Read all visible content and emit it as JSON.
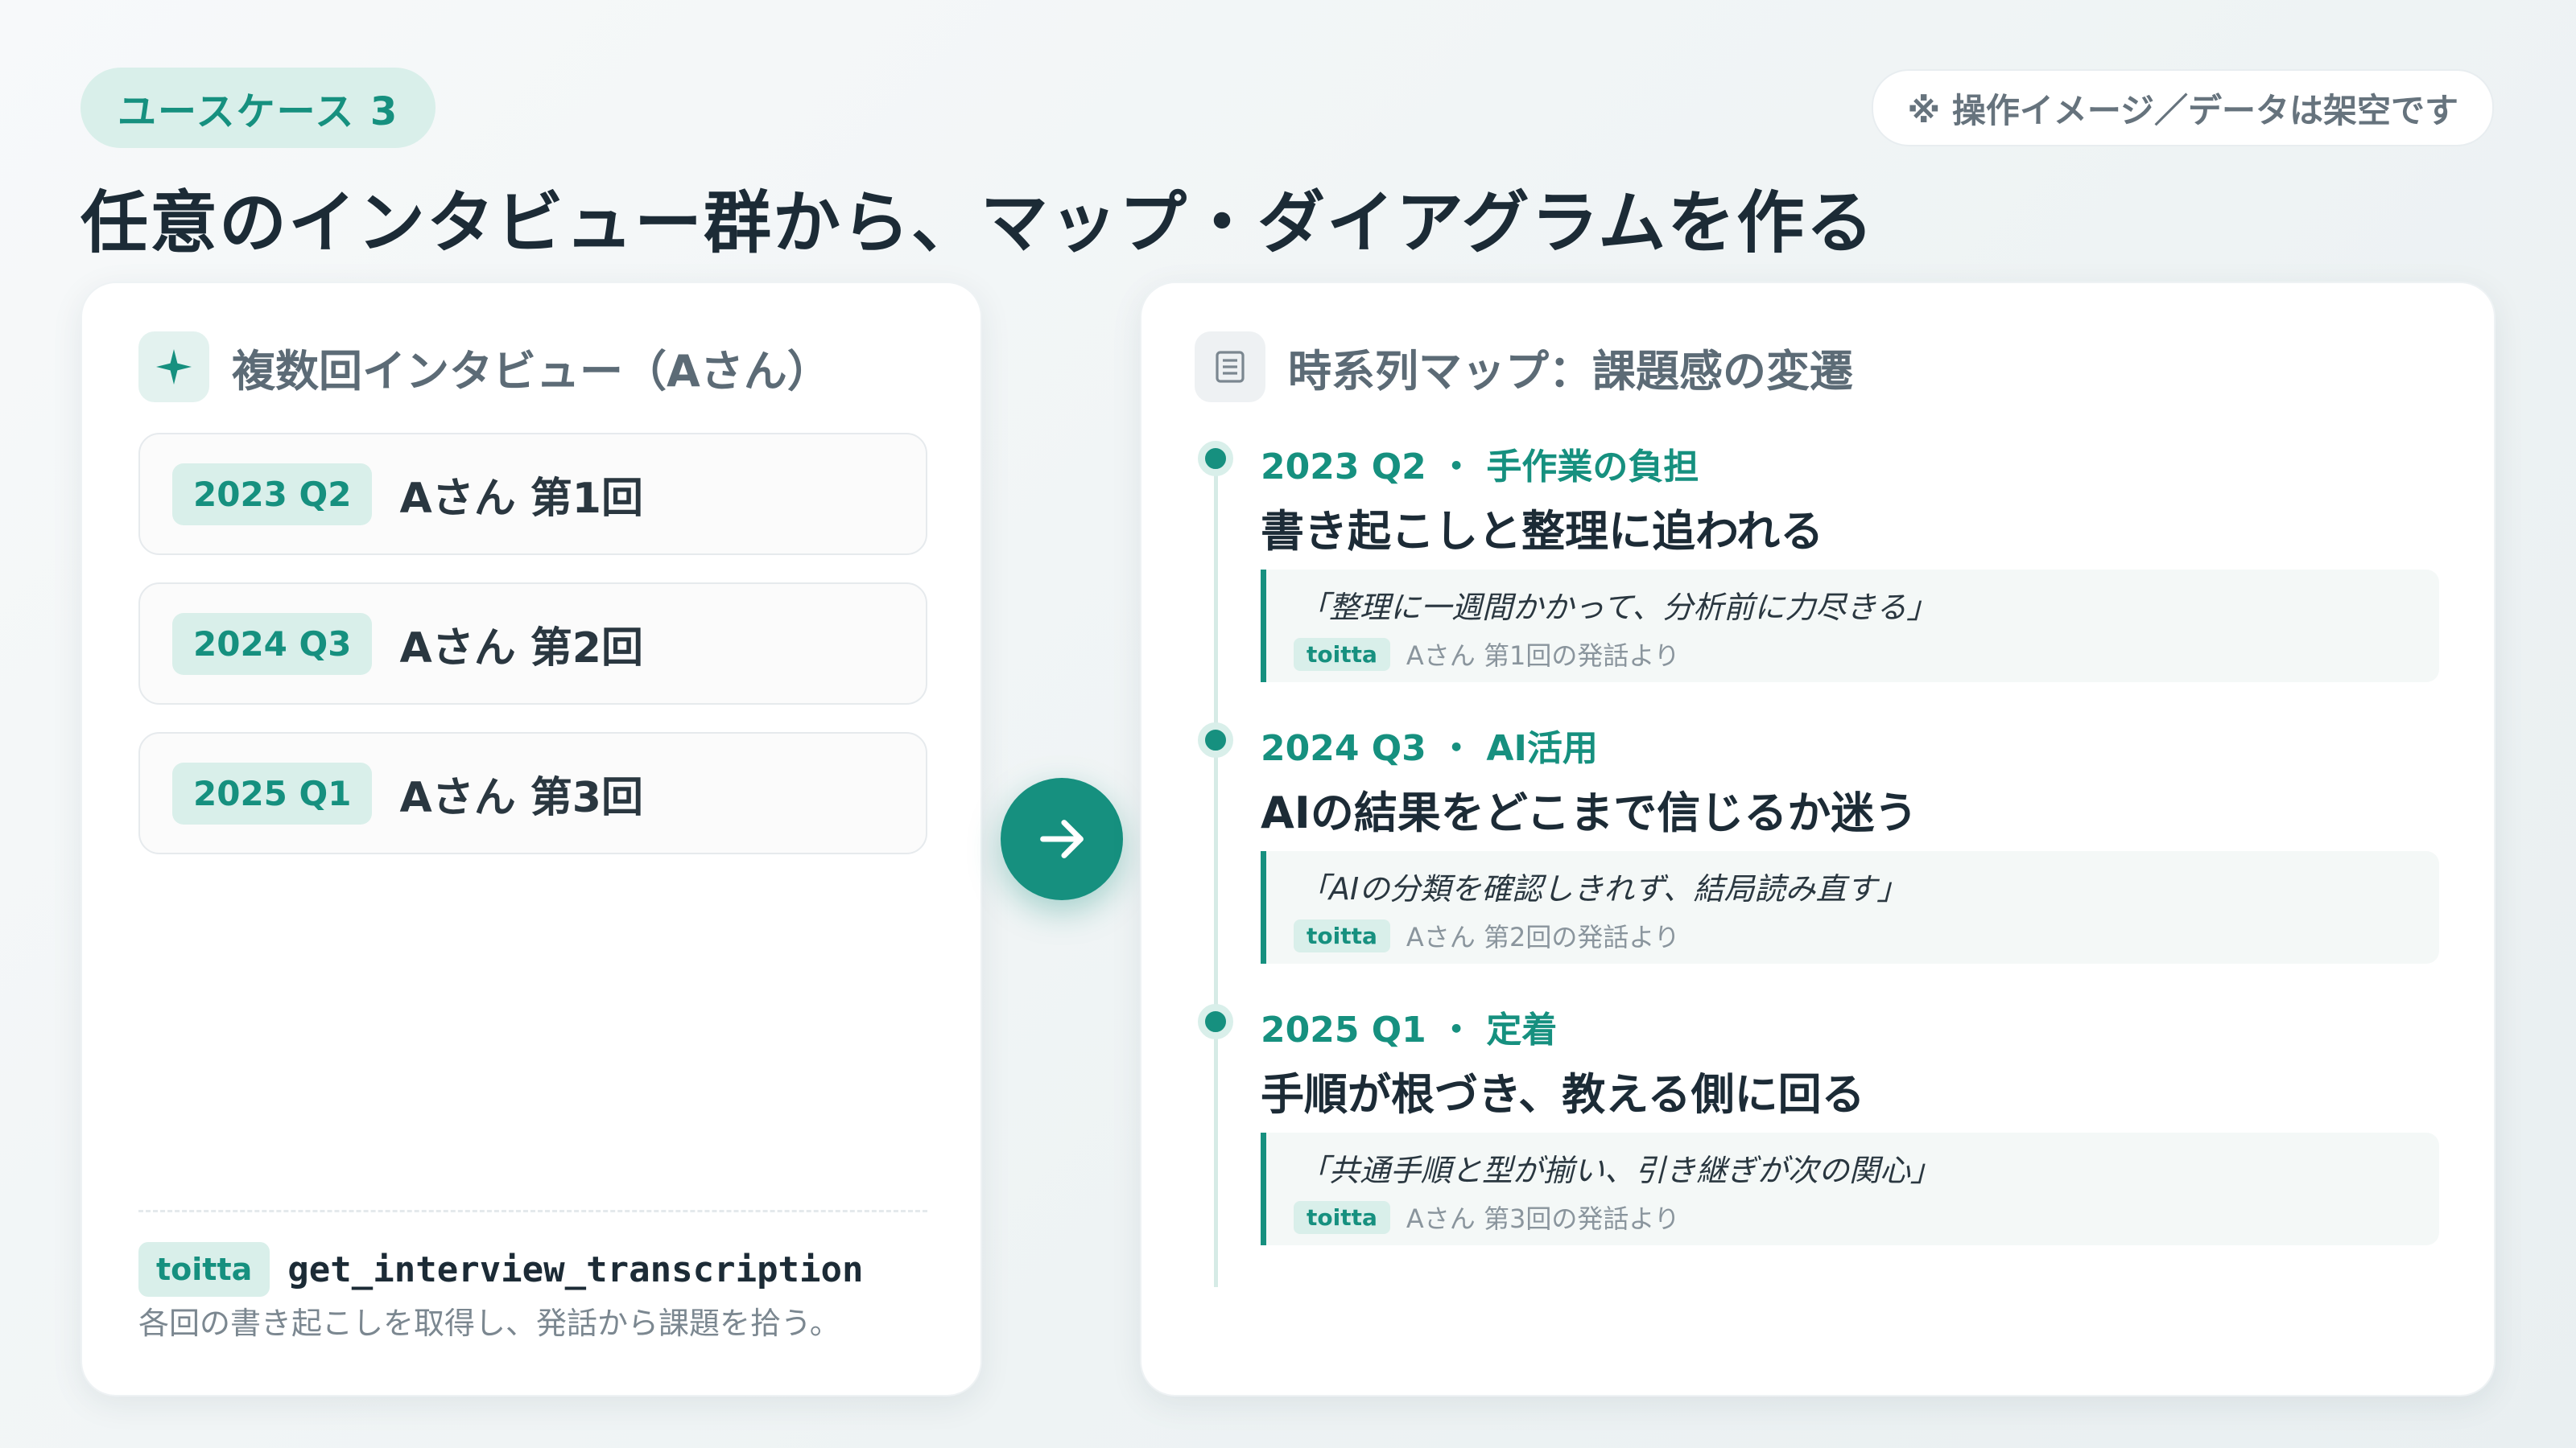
{
  "usecase_label": "ユースケース 3",
  "disclaimer": "※ 操作イメージ／データは架空です",
  "page_title": "任意のインタビュー群から、マップ・ダイアグラムを作る",
  "left_card": {
    "icon": "sparkle-icon",
    "title": "複数回インタビュー（Aさん）",
    "sessions": [
      {
        "period": "2023 Q2",
        "label": "Aさん 第1回"
      },
      {
        "period": "2024 Q3",
        "label": "Aさん 第2回"
      },
      {
        "period": "2025 Q1",
        "label": "Aさん 第3回"
      }
    ],
    "footer": {
      "brand": "toitta",
      "function_name": "get_interview_transcription",
      "description": "各回の書き起こしを取得し、発話から課題を拾う。"
    }
  },
  "arrow_icon": "arrow-right-icon",
  "right_card": {
    "icon": "document-icon",
    "title": "時系列マップ：課題感の変遷",
    "entries": [
      {
        "heading": "2023 Q2 ・ 手作業の負担",
        "title": "書き起こしと整理に追われる",
        "quote": "「整理に一週間かかって、分析前に力尽きる」",
        "source_tag": "toitta",
        "source": "Aさん 第1回の発話より"
      },
      {
        "heading": "2024 Q3 ・ AI活用",
        "title": "AIの結果をどこまで信じるか迷う",
        "quote": "「AIの分類を確認しきれず、結局読み直す」",
        "source_tag": "toitta",
        "source": "Aさん 第2回の発話より"
      },
      {
        "heading": "2025 Q1 ・ 定着",
        "title": "手順が根づき、教える側に回る",
        "quote": "「共通手順と型が揃い、引き継ぎが次の関心」",
        "source_tag": "toitta",
        "source": "Aさん 第3回の発話より"
      }
    ]
  },
  "colors": {
    "accent": "#16907f",
    "accent_light": "#d9efea",
    "text": "#1c2b36"
  }
}
